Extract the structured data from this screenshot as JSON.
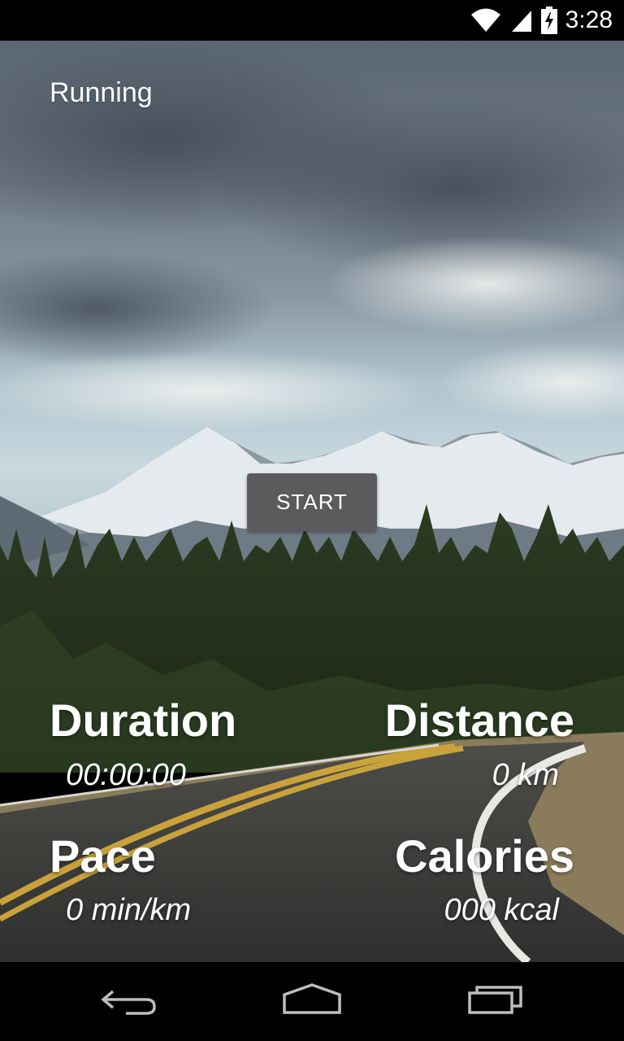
{
  "status_bar": {
    "time": "3:28",
    "icons": [
      "wifi-icon",
      "signal-icon",
      "battery-charging-icon"
    ]
  },
  "app": {
    "title": "Running"
  },
  "controls": {
    "start_label": "START"
  },
  "stats": {
    "duration": {
      "label": "Duration",
      "value": "00:00:00"
    },
    "distance": {
      "label": "Distance",
      "value": "0  km"
    },
    "pace": {
      "label": "Pace",
      "value": "0  min/km"
    },
    "calories": {
      "label": "Calories",
      "value": "000  kcal"
    }
  },
  "nav_bar": {
    "icons": [
      "back-icon",
      "home-icon",
      "recent-apps-icon"
    ]
  },
  "colors": {
    "status_bar_bg": "#000000",
    "button_bg": "#5b5a5c",
    "text": "#ffffff"
  }
}
